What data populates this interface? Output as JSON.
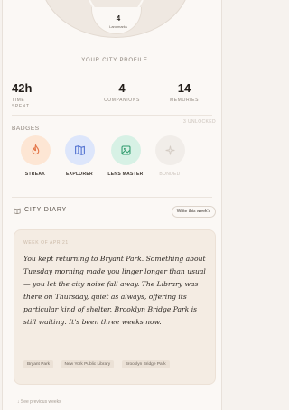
{
  "landmarks": {
    "count": "4",
    "label": "Landmarks"
  },
  "profile": {
    "heading": "YOUR CITY PROFILE",
    "stats": [
      {
        "value": "42h",
        "label": "TIME SPENT"
      },
      {
        "value": "4",
        "label": "COMPANIONS"
      },
      {
        "value": "14",
        "label": "MEMORIES"
      }
    ]
  },
  "badges": {
    "title": "BADGES",
    "count": "3 UNLOCKED",
    "items": [
      {
        "name": "STREAK",
        "icon": "flame-icon",
        "color": "#fde6d4",
        "accent": "#e4774a"
      },
      {
        "name": "EXPLORER",
        "icon": "map-icon",
        "color": "#dde6fb",
        "accent": "#4f6fcf"
      },
      {
        "name": "LENS MASTER",
        "icon": "image-icon",
        "color": "#d7f1e5",
        "accent": "#2f9b6d"
      },
      {
        "name": "BONDED",
        "icon": "sparkle-icon",
        "color": "#f1ede9",
        "accent": "#d4ccc4"
      }
    ]
  },
  "diary": {
    "title": "CITY DIARY",
    "write_label": "Write this week's",
    "week": "WEEK OF APR 21",
    "entry": "You kept returning to Bryant Park. Something about Tuesday morning made you linger longer than usual — you let the city noise fall away. The Library was there on Thursday, quiet as always, offering its particular kind of shelter. Brooklyn Bridge Park is still waiting. It's been three weeks now.",
    "tags": [
      "Bryant Park",
      "New York Public Library",
      "Brooklyn Bridge Park"
    ],
    "see_previous": "↓ See previous weeks"
  }
}
